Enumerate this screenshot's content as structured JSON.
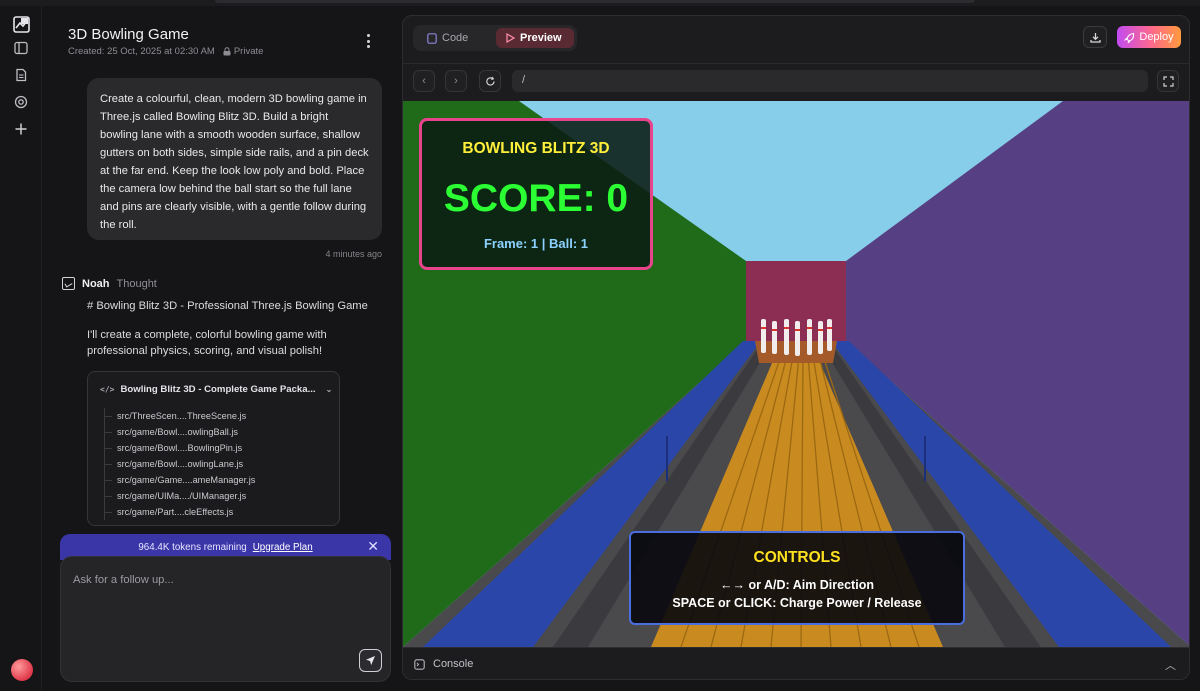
{
  "chat": {
    "title": "3D Bowling Game",
    "created": "Created: 25 Oct, 2025 at 02:30 AM",
    "visibility": "Private",
    "user_message": "Create a colourful, clean, modern 3D bowling game in Three.js called Bowling Blitz 3D. Build a bright bowling lane with a smooth wooden surface, shallow gutters on both sides, simple side rails, and a pin deck at the far end. Keep the look low poly and bold. Place the camera low behind the ball start so the full lane and pins are clearly visible, with a gentle follow during the roll.",
    "user_message_time": "4 minutes ago",
    "agent_name": "Noah",
    "agent_status": "Thought",
    "agent_heading": "# Bowling Blitz 3D - Professional Three.js Bowling Game",
    "agent_paragraph": "I'll create a complete, colorful bowling game with professional physics, scoring, and visual polish!",
    "package": {
      "title": "Bowling Blitz 3D - Complete Game Packa...",
      "files": [
        "src/ThreeScen....ThreeScene.js",
        "src/game/Bowl....owlingBall.js",
        "src/game/Bowl....BowlingPin.js",
        "src/game/Bowl....owlingLane.js",
        "src/game/Game....ameManager.js",
        "src/game/UIMa..../UIManager.js",
        "src/game/Part....cleEffects.js"
      ]
    },
    "tokens_remaining": "964.4K tokens remaining",
    "upgrade_label": "Upgrade Plan",
    "composer_placeholder": "Ask for a follow up..."
  },
  "preview": {
    "tab_code": "Code",
    "tab_preview": "Preview",
    "deploy_label": "Deploy",
    "url": "/",
    "console_label": "Console"
  },
  "game": {
    "title": "BOWLING BLITZ 3D",
    "score": "SCORE: 0",
    "frame_ball": "Frame: 1 | Ball: 1",
    "controls_title": "CONTROLS",
    "controls_line1": "←→ or A/D: Aim Direction",
    "controls_line2": "SPACE or CLICK: Charge Power / Release",
    "colors": {
      "sky": "#87ceeb",
      "left_wall": "#1f6b1a",
      "right_wall": "#563f82",
      "lane_wood": "#c98b1f",
      "gutter_blue": "#2946a8",
      "pin_deck": "#8c2e53",
      "hud_border": "#e8448c",
      "controls_border": "#4a6ee0"
    }
  }
}
